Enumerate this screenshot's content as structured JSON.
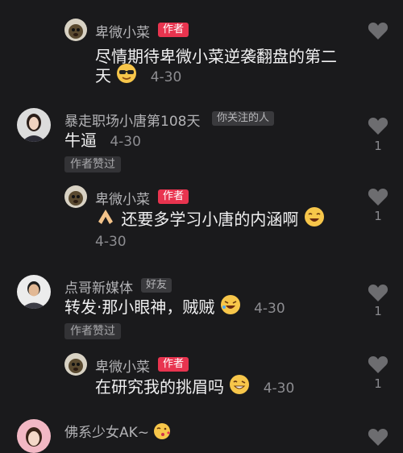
{
  "colors": {
    "background": "#1a1a1c",
    "author_badge": "#e8344f",
    "heart": "#6d6d70"
  },
  "comments": [
    {
      "author": "卑微小菜",
      "badge": "作者",
      "line1": "尽情期待卑微小菜逆袭翻盘的第二",
      "line2": "天",
      "emoji": "sunglasses-emoji",
      "time": "4-30",
      "likes": ""
    },
    {
      "author": "暴走职场小唐第108天",
      "badge": "你关注的人",
      "text": "牛逼",
      "time": "4-30",
      "liked_tag": "作者赞过",
      "likes": "1"
    },
    {
      "author": "卑微小菜",
      "badge": "作者",
      "text": "还要多学习小唐的内涵啊",
      "time": "4-30",
      "likes": "1"
    },
    {
      "author": "点哥新媒体",
      "badge": "好友",
      "text": "转发·那小眼神，贼贼",
      "time": "4-30",
      "liked_tag": "作者赞过",
      "likes": "1"
    },
    {
      "author": "卑微小菜",
      "badge": "作者",
      "text": "在研究我的挑眉吗",
      "time": "4-30",
      "likes": "1"
    },
    {
      "author": "佛系少女AK~"
    }
  ]
}
